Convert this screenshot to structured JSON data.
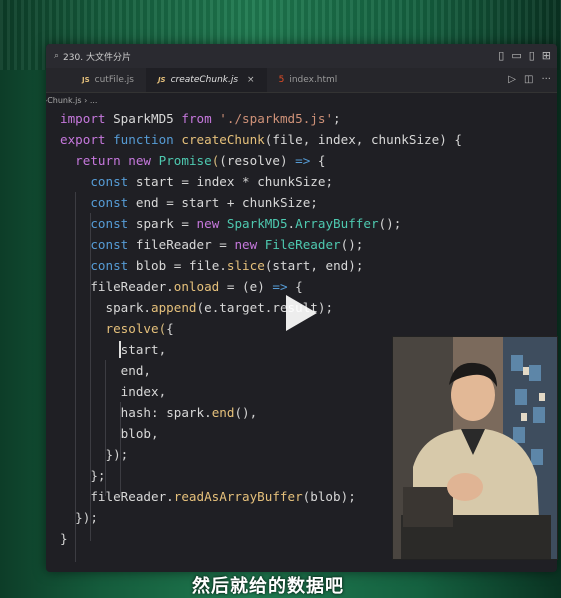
{
  "window": {
    "title": "230. 大文件分片"
  },
  "tabs": [
    {
      "label": "cutFile.js",
      "lang": "JS"
    },
    {
      "label": "createChunk.js",
      "lang": "JS"
    },
    {
      "label": "index.html",
      "lang": "HTML5"
    }
  ],
  "breadcrumb": "›Chunk.js › ...",
  "code_lines": [
    "import SparkMD5 from './sparkmd5.js';",
    "export function createChunk(file, index, chunkSize) {",
    "  return new Promise((resolve) => {",
    "    const start = index * chunkSize;",
    "    const end = start + chunkSize;",
    "    const spark = new SparkMD5.ArrayBuffer();",
    "    const fileReader = new FileReader();",
    "    const blob = file.slice(start, end);",
    "    fileReader.onload = (e) => {",
    "      spark.append(e.target.result);",
    "      resolve({",
    "        start,",
    "        end,",
    "        index,",
    "        hash: spark.end(),",
    "        blob,",
    "      });",
    "    };",
    "    fileReader.readAsArrayBuffer(blob);",
    "  });",
    "}"
  ],
  "subtitle": "然后就给的数据吧",
  "icons": {
    "play": "play-icon",
    "run": "run-icon",
    "split_editor": "split-editor-icon",
    "more": "more-icon"
  },
  "colors": {
    "background_green": "#1f7a50",
    "editor_bg": "#1f1f24",
    "keyword": "#c678dd",
    "keyword_blue": "#569cd6",
    "function": "#e5c07b",
    "string": "#ce9178"
  }
}
